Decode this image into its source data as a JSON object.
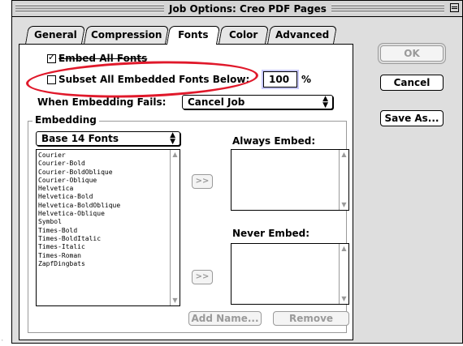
{
  "window": {
    "title": "Job Options: Creo PDF Pages"
  },
  "tabs": [
    {
      "label": "General",
      "active": false
    },
    {
      "label": "Compression",
      "active": false
    },
    {
      "label": "Fonts",
      "active": true
    },
    {
      "label": "Color",
      "active": false
    },
    {
      "label": "Advanced",
      "active": false
    }
  ],
  "fonts": {
    "embed_all": {
      "label": "Embed All Fonts",
      "checked": true
    },
    "subset": {
      "label": "Subset All Embedded Fonts Below:",
      "checked": false,
      "value": "100",
      "unit": "%"
    },
    "when_fails": {
      "label": "When Embedding Fails:",
      "selected": "Cancel Job"
    },
    "embedding": {
      "group_title": "Embedding",
      "source_selected": "Base 14 Fonts",
      "font_list": [
        "Courier",
        "Courier-Bold",
        "Courier-BoldOblique",
        "Courier-Oblique",
        "Helvetica",
        "Helvetica-Bold",
        "Helvetica-BoldOblique",
        "Helvetica-Oblique",
        "Symbol",
        "Times-Bold",
        "Times-BoldItalic",
        "Times-Italic",
        "Times-Roman",
        "ZapfDingbats"
      ],
      "always_embed_label": "Always Embed:",
      "never_embed_label": "Never Embed:",
      "move_button": ">>",
      "add_name_button": "Add Name...",
      "remove_button": "Remove"
    }
  },
  "buttons": {
    "ok": "OK",
    "cancel": "Cancel",
    "save_as": "Save As..."
  },
  "colors": {
    "highlight_oval": "#e0182a"
  }
}
